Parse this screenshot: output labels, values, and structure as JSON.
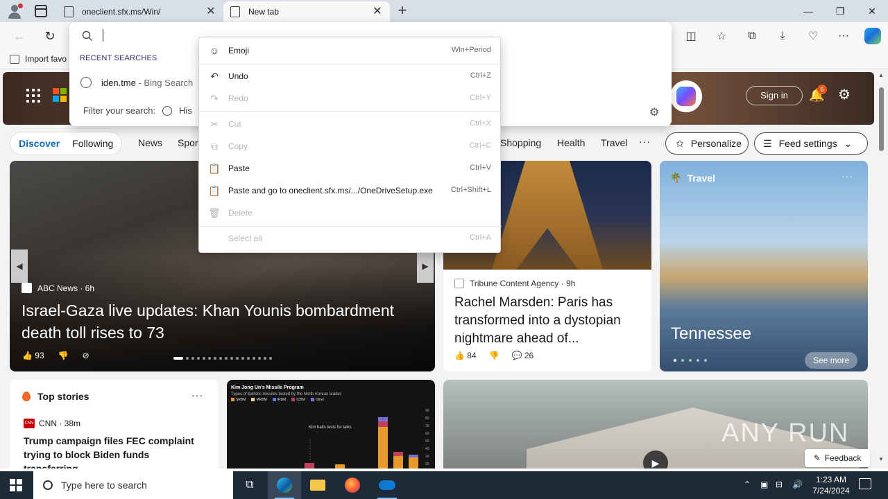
{
  "browser": {
    "tabs": [
      {
        "label": "oneclient.sfx.ms/Win/",
        "active": false
      },
      {
        "label": "New tab",
        "active": true
      }
    ],
    "favorites": {
      "import_label": "Import favo"
    }
  },
  "address_dropdown": {
    "recent_header": "RECENT SEARCHES",
    "recent_items": [
      {
        "query": "iden.tme",
        "detail": " - Bing Search"
      }
    ],
    "filter_label": "Filter your search:",
    "filter_history": "His"
  },
  "context_menu": {
    "items": [
      {
        "label": "Emoji",
        "shortcut": "Win+Period",
        "enabled": true,
        "icon": "emoji-icon"
      },
      {
        "label": "Undo",
        "shortcut": "Ctrl+Z",
        "enabled": true,
        "icon": "undo-icon"
      },
      {
        "label": "Redo",
        "shortcut": "Ctrl+Y",
        "enabled": false,
        "icon": "redo-icon"
      },
      {
        "label": "Cut",
        "shortcut": "Ctrl+X",
        "enabled": false,
        "icon": "cut-icon"
      },
      {
        "label": "Copy",
        "shortcut": "Ctrl+C",
        "enabled": false,
        "icon": "copy-icon"
      },
      {
        "label": "Paste",
        "shortcut": "Ctrl+V",
        "enabled": true,
        "icon": "paste-icon"
      },
      {
        "label": "Paste and go to oneclient.sfx.ms/.../OneDriveSetup.exe",
        "shortcut": "Ctrl+Shift+L",
        "enabled": true,
        "icon": "paste-go-icon"
      },
      {
        "label": "Delete",
        "shortcut": "",
        "enabled": false,
        "icon": "delete-icon"
      },
      {
        "label": "Select all",
        "shortcut": "Ctrl+A",
        "enabled": false,
        "icon": ""
      }
    ]
  },
  "msn": {
    "signin": "Sign in",
    "notifications": "6",
    "nav": {
      "discover": "Discover",
      "following": "Following",
      "links": [
        "News",
        "Spor",
        "Shopping",
        "Health",
        "Travel"
      ],
      "more": "···"
    },
    "personalize": "Personalize",
    "feed_settings": "Feed settings",
    "main_story": {
      "source": "ABC News · 6h",
      "headline": "Israel-Gaza live updates: Khan Younis bombardment death toll rises to 73",
      "likes": "93"
    },
    "paris_story": {
      "source": "Tribune Content Agency · 9h",
      "headline": "Rachel Marsden: Paris has transformed into a dystopian nightmare ahead of...",
      "likes": "84",
      "comments": "26"
    },
    "travel": {
      "category": "Travel",
      "place": "Tennessee",
      "see_more": "See more"
    },
    "top_stories": {
      "title": "Top stories",
      "source": "CNN · 38m",
      "headline": "Trump campaign files FEC complaint trying to block Biden funds transferring..."
    },
    "missile_card": {
      "title": "Kim Jong Un's Missile Program",
      "subtitle": "Types of ballistic missiles tested by the North Korean leader",
      "legend": [
        "SRBM",
        "MRBM",
        "IRBM",
        "ICBM",
        "Other"
      ],
      "note": "Kim halts tests for talks",
      "yticks": [
        "90",
        "80",
        "70",
        "60",
        "50",
        "40",
        "30",
        "20"
      ]
    },
    "feedback": "Feedback",
    "watermark": "ANY RUN"
  },
  "taskbar": {
    "search_placeholder": "Type here to search",
    "time": "1:23 AM",
    "date": "7/24/2024"
  },
  "colors": {
    "accent": "#0f6cbd",
    "taskbar": "#1f2a38",
    "titlebar": "#d9dfe7"
  }
}
